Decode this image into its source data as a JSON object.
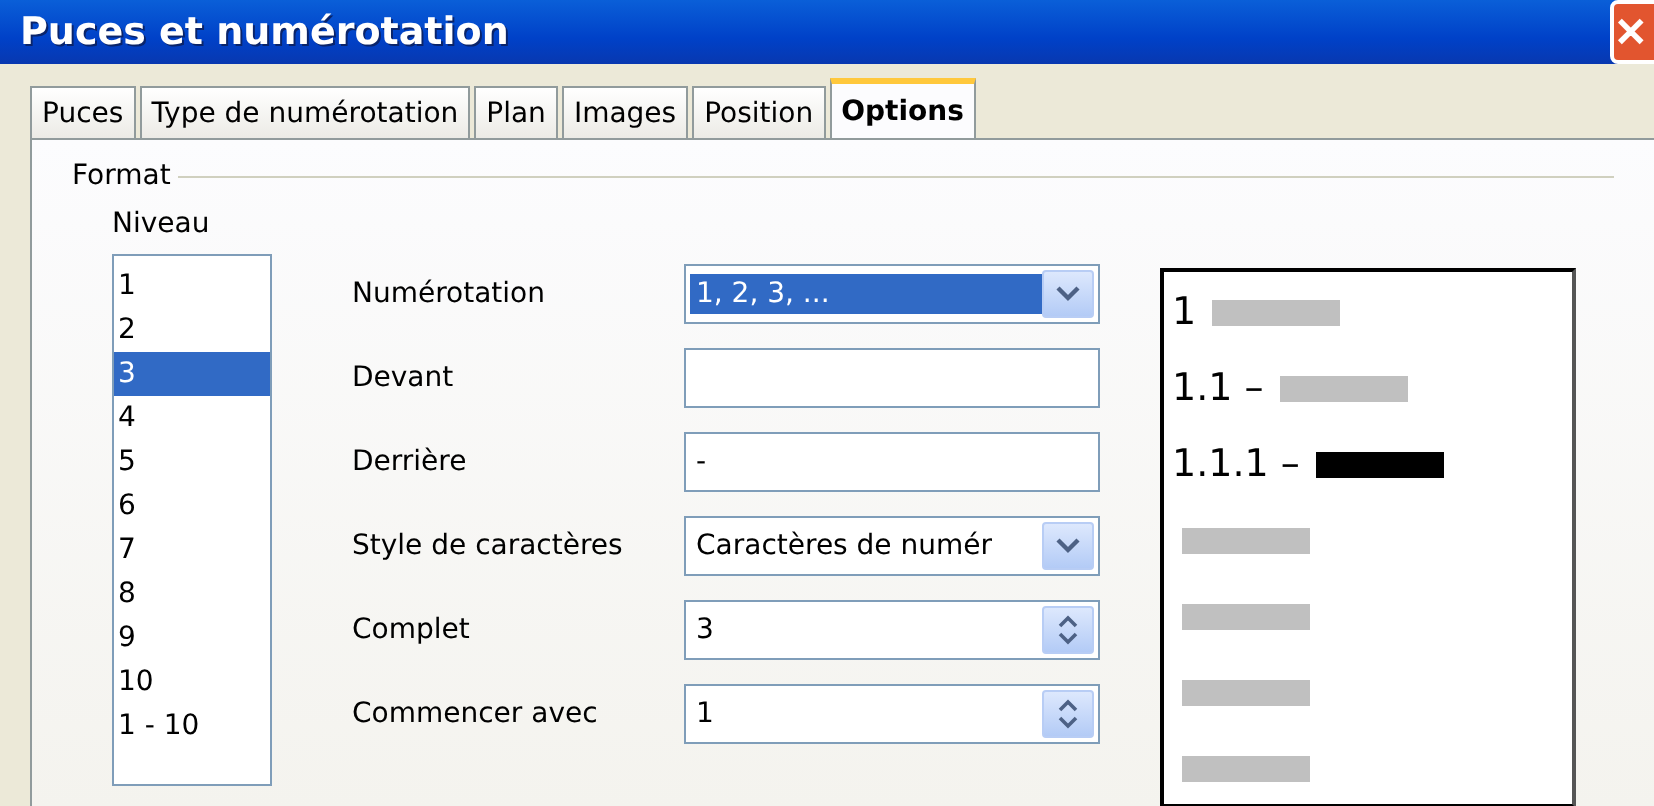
{
  "window": {
    "title": "Puces et numérotation",
    "close": "✕"
  },
  "tabs": [
    {
      "label": "Puces",
      "selected": false
    },
    {
      "label": "Type de numérotation",
      "selected": false
    },
    {
      "label": "Plan",
      "selected": false
    },
    {
      "label": "Images",
      "selected": false
    },
    {
      "label": "Position",
      "selected": false
    },
    {
      "label": "Options",
      "selected": true
    }
  ],
  "format": {
    "title": "Format",
    "level_label": "Niveau",
    "levels": [
      {
        "label": "1",
        "selected": false
      },
      {
        "label": "2",
        "selected": false
      },
      {
        "label": "3",
        "selected": true
      },
      {
        "label": "4",
        "selected": false
      },
      {
        "label": "5",
        "selected": false
      },
      {
        "label": "6",
        "selected": false
      },
      {
        "label": "7",
        "selected": false
      },
      {
        "label": "8",
        "selected": false
      },
      {
        "label": "9",
        "selected": false
      },
      {
        "label": "10",
        "selected": false
      },
      {
        "label": "1 - 10",
        "selected": false
      }
    ],
    "fields": [
      {
        "label": "Numérotation",
        "kind": "dropdown",
        "value": "1, 2, 3, ...",
        "focused": true
      },
      {
        "label": "Devant",
        "kind": "text"
      },
      {
        "label": "Derrière",
        "kind": "text",
        "value": "-"
      },
      {
        "label": "Style de caractères",
        "kind": "dropdown",
        "value": "Caractères de numér",
        "focused": false
      },
      {
        "label": "Complet",
        "kind": "spin",
        "value": "3"
      },
      {
        "label": "Commencer avec",
        "kind": "spin",
        "value": "1"
      }
    ]
  },
  "preview": [
    {
      "number": "1",
      "current": false
    },
    {
      "number": "1.1 –",
      "current": false
    },
    {
      "number": "1.1.1 –",
      "current": true
    },
    {
      "current": false
    },
    {
      "current": false
    },
    {
      "current": false
    },
    {
      "current": false
    }
  ]
}
